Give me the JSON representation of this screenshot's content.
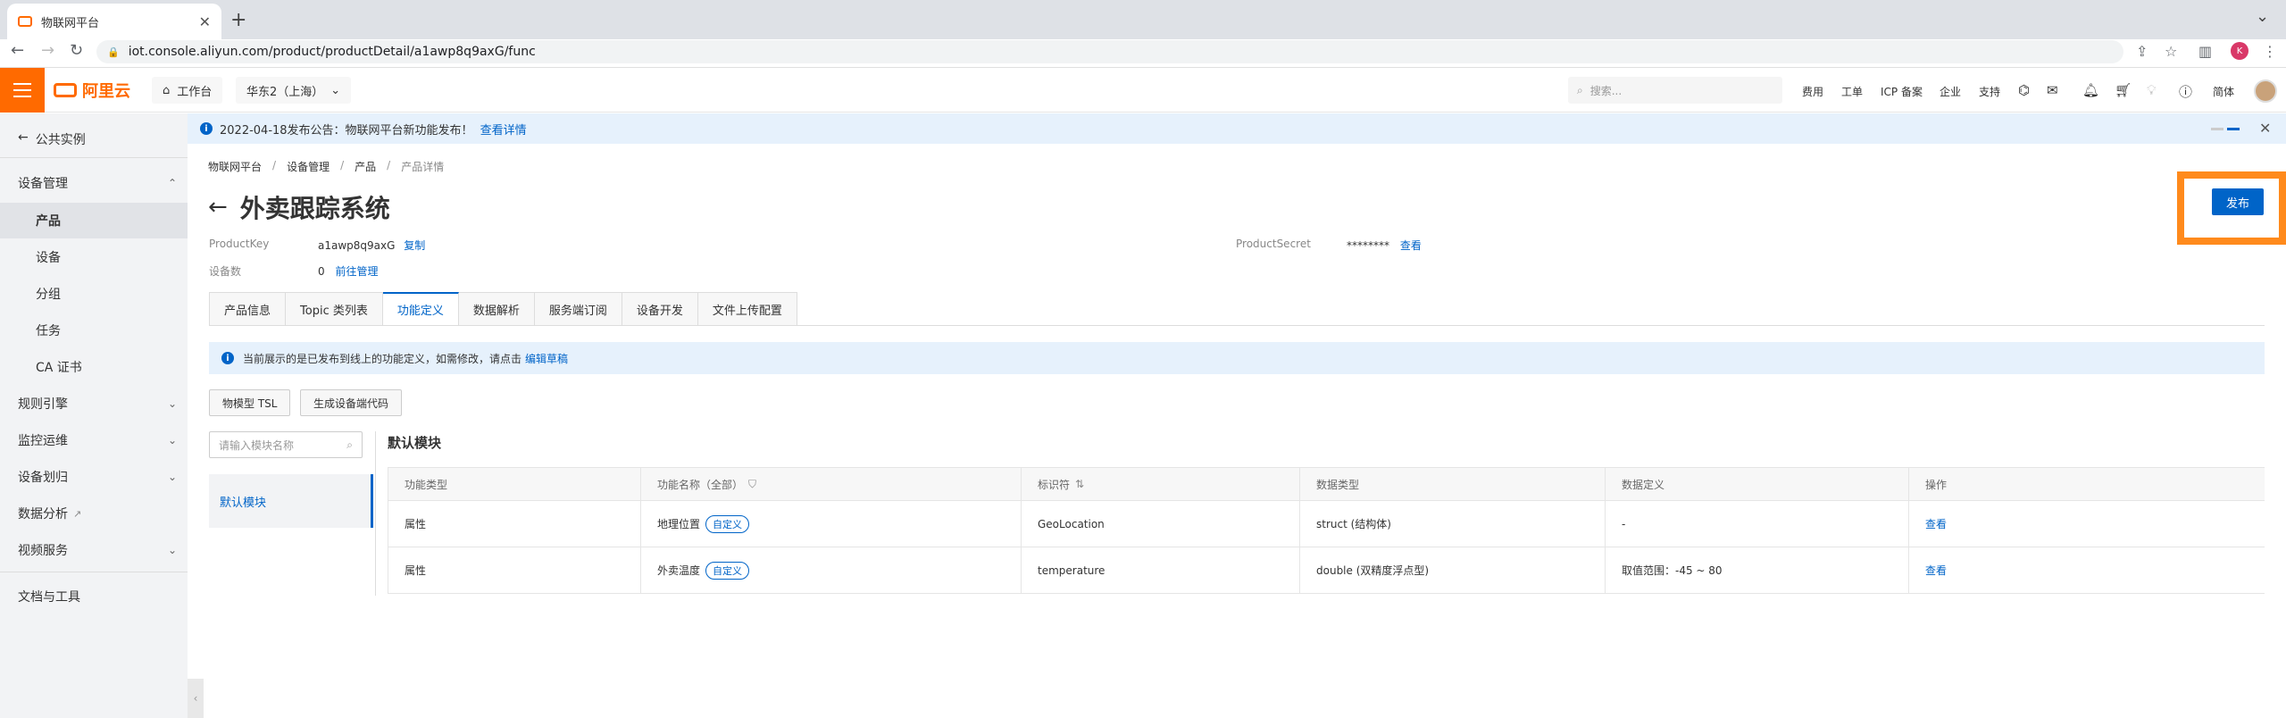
{
  "browser": {
    "tab_title": "物联网平台",
    "url": "iot.console.aliyun.com/product/productDetail/a1awp8q9axG/func",
    "profile_initial": "K"
  },
  "topbar": {
    "logo_text": "阿里云",
    "workbench": "工作台",
    "region": "华东2（上海）",
    "search_placeholder": "搜索...",
    "nav": [
      "费用",
      "工单",
      "ICP 备案",
      "企业",
      "支持"
    ],
    "lang": "简体"
  },
  "sidebar": {
    "back": "公共实例",
    "groups": [
      {
        "label": "设备管理"
      },
      {
        "label": "产品"
      },
      {
        "label": "设备"
      },
      {
        "label": "分组"
      },
      {
        "label": "任务"
      },
      {
        "label": "CA 证书"
      },
      {
        "label": "规则引擎"
      },
      {
        "label": "监控运维"
      },
      {
        "label": "设备划归"
      },
      {
        "label": "数据分析"
      },
      {
        "label": "视频服务"
      },
      {
        "label": "文档与工具"
      }
    ]
  },
  "announcement": {
    "text": "2022-04-18发布公告：物联网平台新功能发布！",
    "link": "查看详情"
  },
  "breadcrumb": [
    "物联网平台",
    "设备管理",
    "产品",
    "产品详情"
  ],
  "page": {
    "title": "外卖跟踪系统",
    "product_key_label": "ProductKey",
    "product_key": "a1awp8q9axG",
    "copy": "复制",
    "device_count_label": "设备数",
    "device_count": "0",
    "manage_link": "前往管理",
    "product_secret_label": "ProductSecret",
    "product_secret": "********",
    "view": "查看",
    "publish": "发布"
  },
  "tabs": [
    "产品信息",
    "Topic 类列表",
    "功能定义",
    "数据解析",
    "服务端订阅",
    "设备开发",
    "文件上传配置"
  ],
  "notice": {
    "text": "当前展示的是已发布到线上的功能定义，如需修改，请点击",
    "link": "编辑草稿"
  },
  "buttons": {
    "tsl": "物模型 TSL",
    "gen_code": "生成设备端代码"
  },
  "module": {
    "search_placeholder": "请输入模块名称",
    "item": "默认模块",
    "section_title": "默认模块"
  },
  "table": {
    "headers": [
      "功能类型",
      "功能名称（全部）",
      "标识符",
      "数据类型",
      "数据定义",
      "操作"
    ],
    "rows": [
      {
        "type": "属性",
        "name": "地理位置",
        "tag": "自定义",
        "id": "GeoLocation",
        "dtype": "struct (结构体)",
        "def": "-",
        "op": "查看"
      },
      {
        "type": "属性",
        "name": "外卖温度",
        "tag": "自定义",
        "id": "temperature",
        "dtype": "double (双精度浮点型)",
        "def": "取值范围：-45 ~ 80",
        "op": "查看"
      }
    ]
  }
}
